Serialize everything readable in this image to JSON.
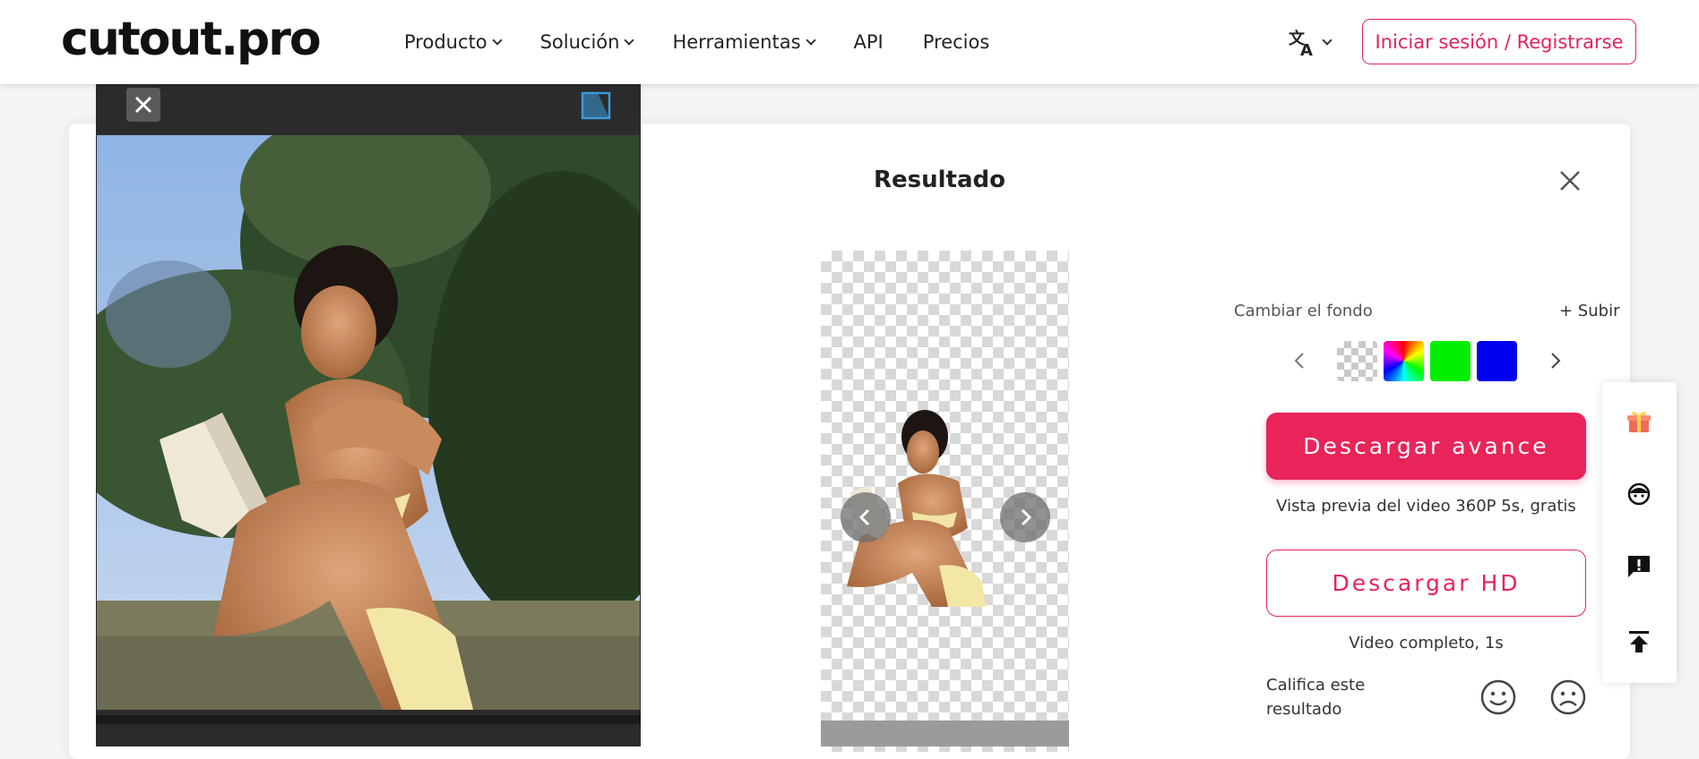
{
  "brand": {
    "logo_text": "cutout.pro"
  },
  "nav": {
    "items": [
      {
        "label": "Producto",
        "has_dropdown": true
      },
      {
        "label": "Solución",
        "has_dropdown": true
      },
      {
        "label": "Herramientas",
        "has_dropdown": true
      },
      {
        "label": "API",
        "has_dropdown": false
      },
      {
        "label": "Precios",
        "has_dropdown": false
      }
    ],
    "language_icon": "translate-icon",
    "login_label": "Iniciar sesión / Registrarse"
  },
  "result": {
    "title": "Resultado",
    "background": {
      "label": "Cambiar el fondo",
      "upload_label": "+ Subir",
      "swatches": [
        {
          "name": "transparent"
        },
        {
          "name": "rainbow"
        },
        {
          "name": "green",
          "color": "#00ff00"
        },
        {
          "name": "blue",
          "color": "#0000ff"
        }
      ]
    },
    "download_preview": {
      "label": "Descargar avance",
      "subtitle": "Vista previa del video 360P 5s, gratis"
    },
    "download_hd": {
      "label": "Descargar HD",
      "subtitle": "Video completo, 1s"
    },
    "rating": {
      "label": "Califica este resultado"
    }
  },
  "side_tools": [
    "gift-icon",
    "support-agent-icon",
    "feedback-icon",
    "back-to-top-icon"
  ],
  "colors": {
    "accent": "#e8245a",
    "panel_dark": "#2b2b2b"
  }
}
